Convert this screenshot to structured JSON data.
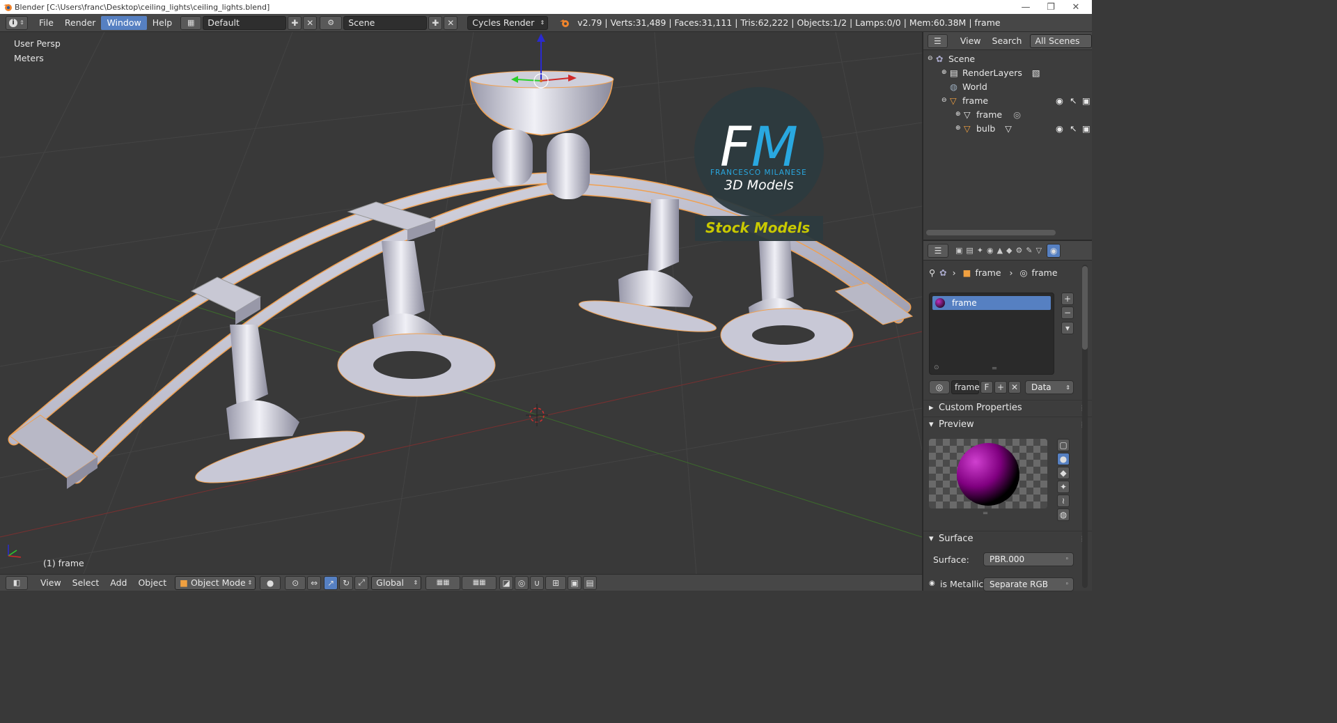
{
  "window": {
    "title": "Blender [C:\\Users\\franc\\Desktop\\ceiling_lights\\ceiling_lights.blend]",
    "minimize": "—",
    "maximize": "❐",
    "close": "✕"
  },
  "menu": {
    "file": "File",
    "render": "Render",
    "window": "Window",
    "help": "Help"
  },
  "header": {
    "layout": "Default",
    "scene": "Scene",
    "engine": "Cycles Render",
    "stats": "v2.79 | Verts:31,489 | Faces:31,111 | Tris:62,222 | Objects:1/2 | Lamps:0/0 | Mem:60.38M | frame"
  },
  "viewport": {
    "view_name": "User Persp",
    "units": "Meters",
    "active_object": "(1) frame",
    "watermark": {
      "letters": "FM",
      "author": "FRANCESCO MILANESE",
      "line2": "3D Models",
      "banner": "Stock Models"
    }
  },
  "bottombar": {
    "view": "View",
    "select": "Select",
    "add": "Add",
    "object": "Object",
    "mode": "Object Mode",
    "orientation": "Global"
  },
  "outliner": {
    "view": "View",
    "search": "Search",
    "filter": "All Scenes",
    "items": [
      {
        "label": "Scene"
      },
      {
        "label": "RenderLayers"
      },
      {
        "label": "World"
      },
      {
        "label": "frame"
      },
      {
        "label": "frame"
      },
      {
        "label": "bulb"
      }
    ]
  },
  "properties": {
    "breadcrumb_object": "frame",
    "breadcrumb_material": "frame",
    "slot_name": "frame",
    "material_name": "frame",
    "fake_user": "F",
    "link": "Data",
    "custom_properties": "Custom Properties",
    "preview": "Preview",
    "surface_panel": "Surface",
    "surface_label": "Surface:",
    "surface_value": "PBR.000",
    "metallic_label": "is Metallic",
    "metallic_value": "Separate RGB"
  },
  "colors": {
    "accent": "#5680c2",
    "viewport_bg": "#393939",
    "header_bg": "#474747",
    "watermark_cyan": "#29a8e0",
    "banner_yellow": "#c8c800"
  }
}
